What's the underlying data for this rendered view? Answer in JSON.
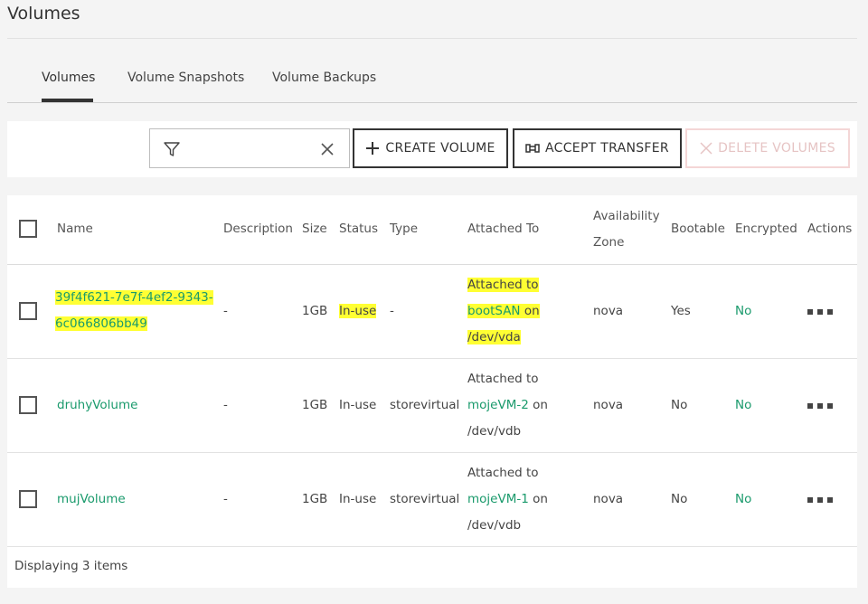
{
  "page": {
    "title": "Volumes"
  },
  "tabs": [
    {
      "label": "Volumes",
      "active": true
    },
    {
      "label": "Volume Snapshots",
      "active": false
    },
    {
      "label": "Volume Backups",
      "active": false
    }
  ],
  "toolbar": {
    "search": {
      "value": "",
      "placeholder": ""
    },
    "create_label": "CREATE VOLUME",
    "accept_label": "ACCEPT TRANSFER",
    "delete_label": "DELETE VOLUMES"
  },
  "table": {
    "headers": {
      "name": "Name",
      "description": "Description",
      "size": "Size",
      "status": "Status",
      "type": "Type",
      "attached": "Attached To",
      "az_line1": "Availability",
      "az_line2": "Zone",
      "bootable": "Bootable",
      "encrypted": "Encrypted",
      "actions": "Actions"
    },
    "rows": [
      {
        "name_line1": "39f4f621-7e7f-4ef2-9343-",
        "name_line2": "6c066806bb49",
        "description": "-",
        "size": "1GB",
        "status": "In-use",
        "type": "-",
        "attached_prefix": "Attached to",
        "attached_vm": "bootSAN",
        "attached_on": " on",
        "attached_dev": "/dev/vda",
        "az": "nova",
        "bootable": "Yes",
        "encrypted": "No"
      },
      {
        "name": "druhyVolume",
        "description": "-",
        "size": "1GB",
        "status": "In-use",
        "type": "storevirtual",
        "attached_prefix": "Attached to",
        "attached_vm": "mojeVM-2",
        "attached_on": " on",
        "attached_dev": "/dev/vdb",
        "az": "nova",
        "bootable": "No",
        "encrypted": "No"
      },
      {
        "name": "mujVolume",
        "description": "-",
        "size": "1GB",
        "status": "In-use",
        "type": "storevirtual",
        "attached_prefix": "Attached to",
        "attached_vm": "mojeVM-1",
        "attached_on": " on",
        "attached_dev": "/dev/vdb",
        "az": "nova",
        "bootable": "No",
        "encrypted": "No"
      }
    ],
    "footer": "Displaying 3 items"
  },
  "colors": {
    "link": "#1a9a6c",
    "highlight": "#ffff33",
    "disabled": "#f4d6d6"
  },
  "icons": [
    "filter-icon",
    "clear-icon",
    "plus-icon",
    "transfer-icon",
    "delete-x-icon",
    "more-actions-icon"
  ]
}
